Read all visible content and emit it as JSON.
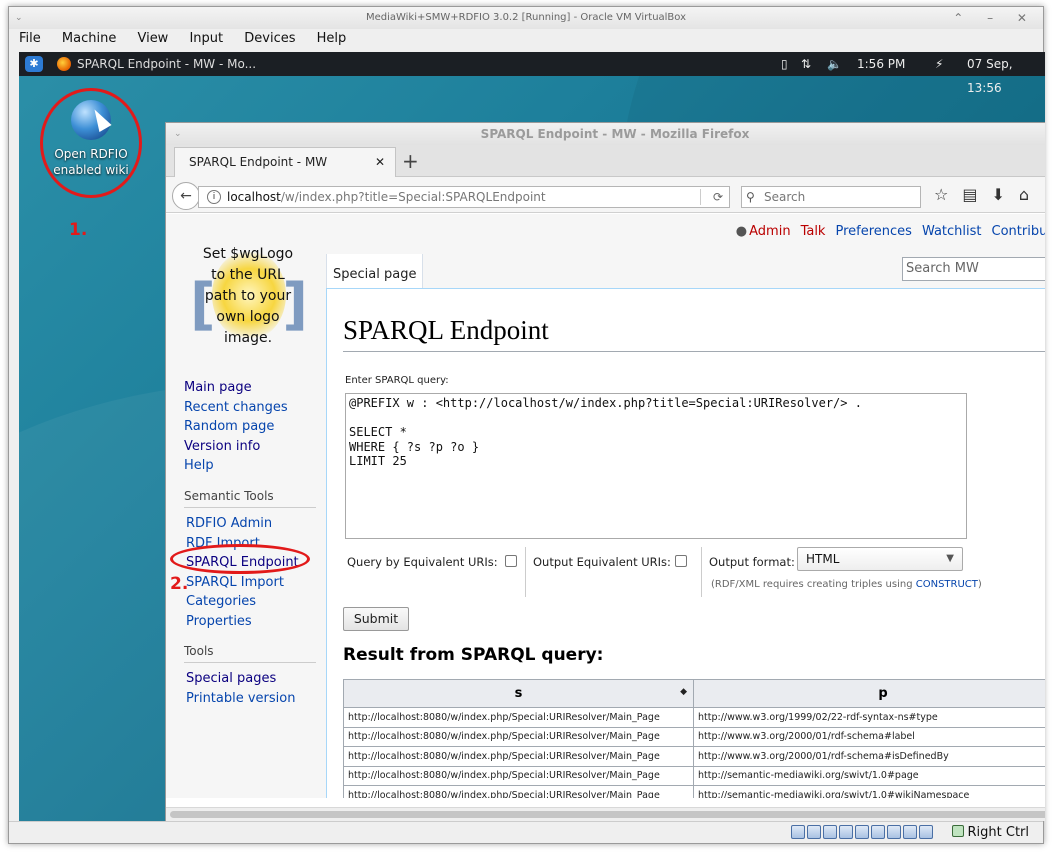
{
  "vbox": {
    "title": "MediaWiki+SMW+RDFIO 3.0.2 [Running] - Oracle VM VirtualBox",
    "menu": [
      "File",
      "Machine",
      "View",
      "Input",
      "Devices",
      "Help"
    ],
    "window_controls": "⌃ – ✕",
    "status_host_key": "Right Ctrl"
  },
  "panel": {
    "task_label": "SPARQL Endpoint - MW - Mo...",
    "clock": "1:56 PM",
    "date": "07 Sep, 13:56"
  },
  "desktop": {
    "icon_label_line1": "Open RDFIO",
    "icon_label_line2": "enabled wiki",
    "annotation_1": "1.",
    "annotation_2": "2."
  },
  "firefox": {
    "title": "SPARQL Endpoint - MW - Mozilla Firefox",
    "tab_title": "SPARQL Endpoint - MW",
    "url_host": "localhost",
    "url_path": "/w/index.php?title=Special:SPARQLEndpoint",
    "search_placeholder": "Search"
  },
  "wiki": {
    "personal": {
      "user": "Admin",
      "talk": "Talk",
      "preferences": "Preferences",
      "watchlist": "Watchlist",
      "contributions": "Contributio"
    },
    "logo_text": [
      "Set $wgLogo",
      "to the URL",
      "path to your",
      "own logo",
      "image."
    ],
    "nav": [
      "Main page",
      "Recent changes",
      "Random page",
      "Version info",
      "Help"
    ],
    "semantic_tools_heading": "Semantic Tools",
    "semantic_tools": [
      "RDFIO Admin",
      "RDF Import",
      "SPARQL Endpoint",
      "SPARQL Import",
      "Categories",
      "Properties"
    ],
    "tools_heading": "Tools",
    "tools": [
      "Special pages",
      "Printable version"
    ],
    "special_tab": "Special page",
    "search_placeholder": "Search MW",
    "page_title": "SPARQL Endpoint",
    "query_label": "Enter SPARQL query:",
    "query_text": "@PREFIX w : <http://localhost/w/index.php?title=Special:URIResolver/> .\n\nSELECT *\nWHERE { ?s ?p ?o }\nLIMIT 25",
    "query_equiv_label": "Query by Equivalent URIs:",
    "output_equiv_label": "Output Equivalent URIs:",
    "output_format_label": "Output format:",
    "output_format_value": "HTML",
    "note_prefix": "(RDF/XML requires creating triples using ",
    "note_link": "CONSTRUCT",
    "note_suffix": ")",
    "submit_label": "Submit",
    "result_heading": "Result from SPARQL query:",
    "columns": [
      "s",
      "p"
    ],
    "rows": [
      [
        "http://localhost:8080/w/index.php/Special:URIResolver/Main_Page",
        "http://www.w3.org/1999/02/22-rdf-syntax-ns#type"
      ],
      [
        "http://localhost:8080/w/index.php/Special:URIResolver/Main_Page",
        "http://www.w3.org/2000/01/rdf-schema#label"
      ],
      [
        "http://localhost:8080/w/index.php/Special:URIResolver/Main_Page",
        "http://www.w3.org/2000/01/rdf-schema#isDefinedBy"
      ],
      [
        "http://localhost:8080/w/index.php/Special:URIResolver/Main_Page",
        "http://semantic-mediawiki.org/swivt/1.0#page"
      ],
      [
        "http://localhost:8080/w/index.php/Special:URIResolver/Main_Page",
        "http://semantic-mediawiki.org/swivt/1.0#wikiNamespace"
      ]
    ]
  },
  "colors": {
    "annotation_red": "#e21a1a",
    "link_blue": "#0645ad",
    "desktop_teal": "#1d7f9b"
  }
}
